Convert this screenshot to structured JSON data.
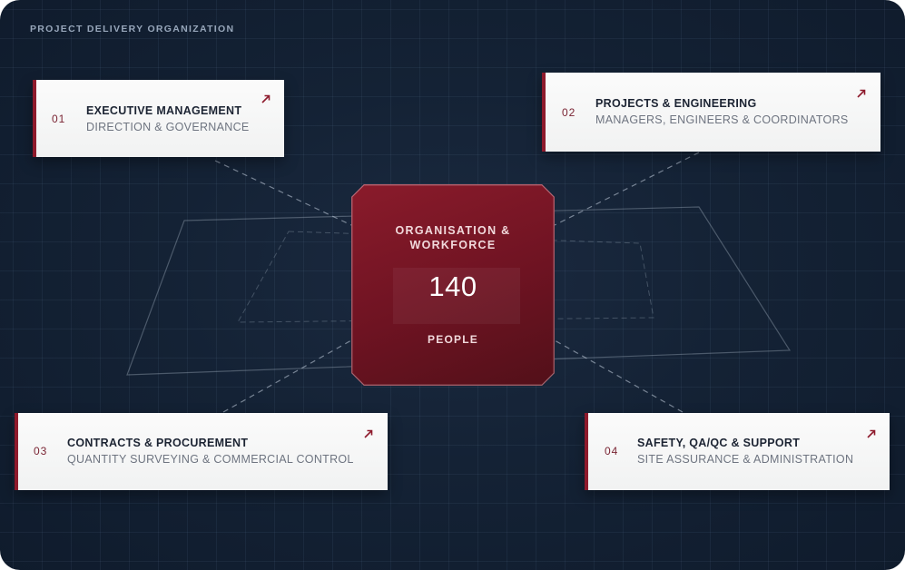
{
  "header": {
    "title": "PROJECT DELIVERY ORGANIZATION"
  },
  "center": {
    "label": "ORGANISATION & WORKFORCE",
    "value": "140",
    "unit": "PEOPLE"
  },
  "cards": [
    {
      "number": "01",
      "title": "EXECUTIVE MANAGEMENT",
      "subtitle": "DIRECTION & GOVERNANCE",
      "icon": "arrow-up-right-icon"
    },
    {
      "number": "02",
      "title": "PROJECTS & ENGINEERING",
      "subtitle": "MANAGERS, ENGINEERS & COORDINATORS",
      "icon": "arrow-up-right-icon"
    },
    {
      "number": "03",
      "title": "CONTRACTS & PROCUREMENT",
      "subtitle": "QUANTITY SURVEYING & COMMERCIAL CONTROL",
      "icon": "arrow-up-right-icon"
    },
    {
      "number": "04",
      "title": "SAFETY, QA/QC & SUPPORT",
      "subtitle": "SITE ASSURANCE & ADMINISTRATION",
      "icon": "arrow-up-right-icon"
    }
  ],
  "colors": {
    "accent": "#8e1a2c",
    "background": "#142235",
    "card": "#f4f4f4"
  }
}
